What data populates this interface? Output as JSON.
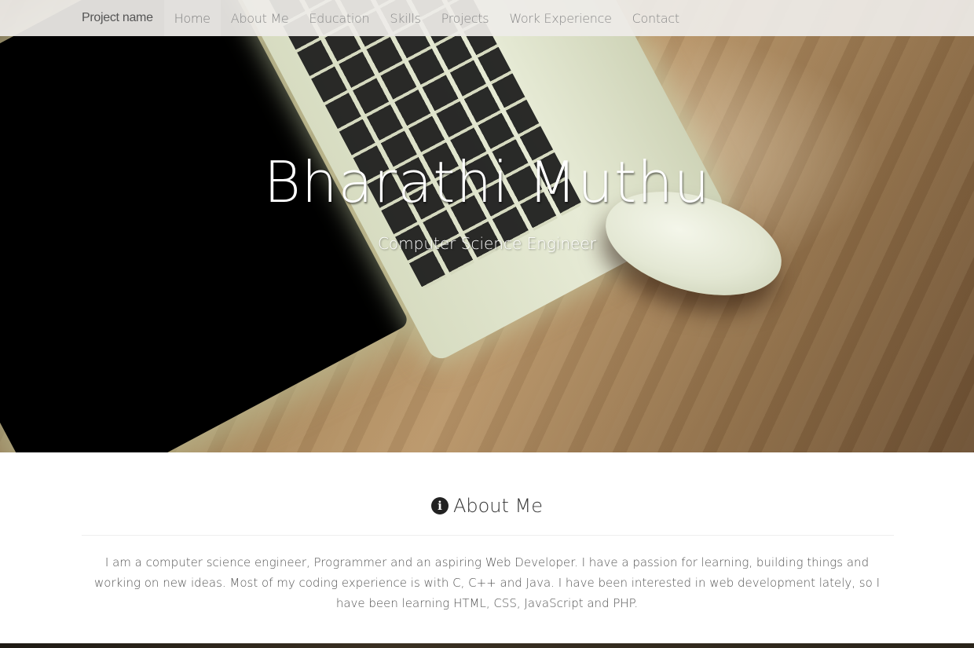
{
  "navbar": {
    "brand": "Project name",
    "items": [
      {
        "label": "Home",
        "active": true
      },
      {
        "label": "About Me",
        "active": false
      },
      {
        "label": "Education",
        "active": false
      },
      {
        "label": "Skills",
        "active": false
      },
      {
        "label": "Projects",
        "active": false
      },
      {
        "label": "Work Experience",
        "active": false
      },
      {
        "label": "Contact",
        "active": false
      }
    ]
  },
  "hero": {
    "name": "Bharathi Muthu",
    "subtitle": "Computer Science Engineer"
  },
  "about": {
    "icon": "info-icon",
    "title": "About Me",
    "text": "I am a computer science engineer, Programmer and an aspiring Web Developer. I have a passion for learning, building things and working on new ideas. Most of my coding experience is with C, C++ and Java. I have been interested in web development lately, so I have been learning HTML, CSS, JavaScript and PHP."
  }
}
